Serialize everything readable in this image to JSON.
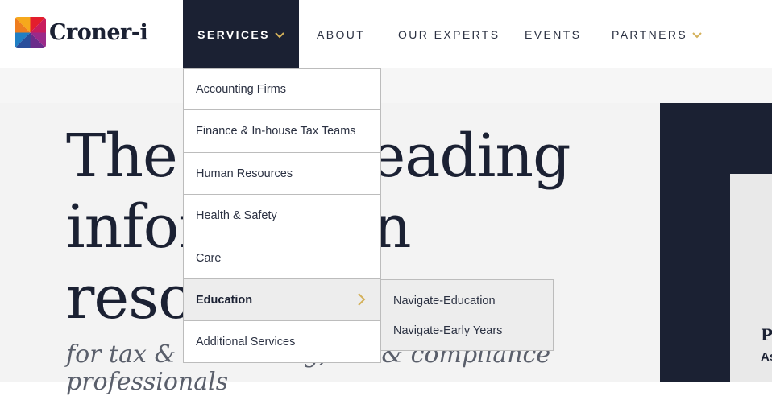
{
  "brand": {
    "name": "Croner-i"
  },
  "nav": {
    "services": "SERVICES",
    "about": "ABOUT",
    "experts": "OUR EXPERTS",
    "events": "EVENTS",
    "partners": "PARTNERS"
  },
  "dropdown": {
    "items": [
      "Accounting Firms",
      "Finance & In-house Tax Teams",
      "Human Resources",
      "Health & Safety",
      "Care",
      "Education",
      "Additional Services"
    ],
    "active_index": 5
  },
  "submenu": {
    "items": [
      "Navigate-Education",
      "Navigate-Early Years"
    ]
  },
  "hero": {
    "line1": "The UK's leading",
    "line2": "information",
    "line3": "resources",
    "subtitle": "for tax & accounting, HR & compliance professionals"
  },
  "side_card": {
    "line1": "P",
    "line2": "As"
  },
  "colors": {
    "navy": "#1b2133",
    "gold": "#d4b15a",
    "hero_bg": "#f3f3f3"
  }
}
